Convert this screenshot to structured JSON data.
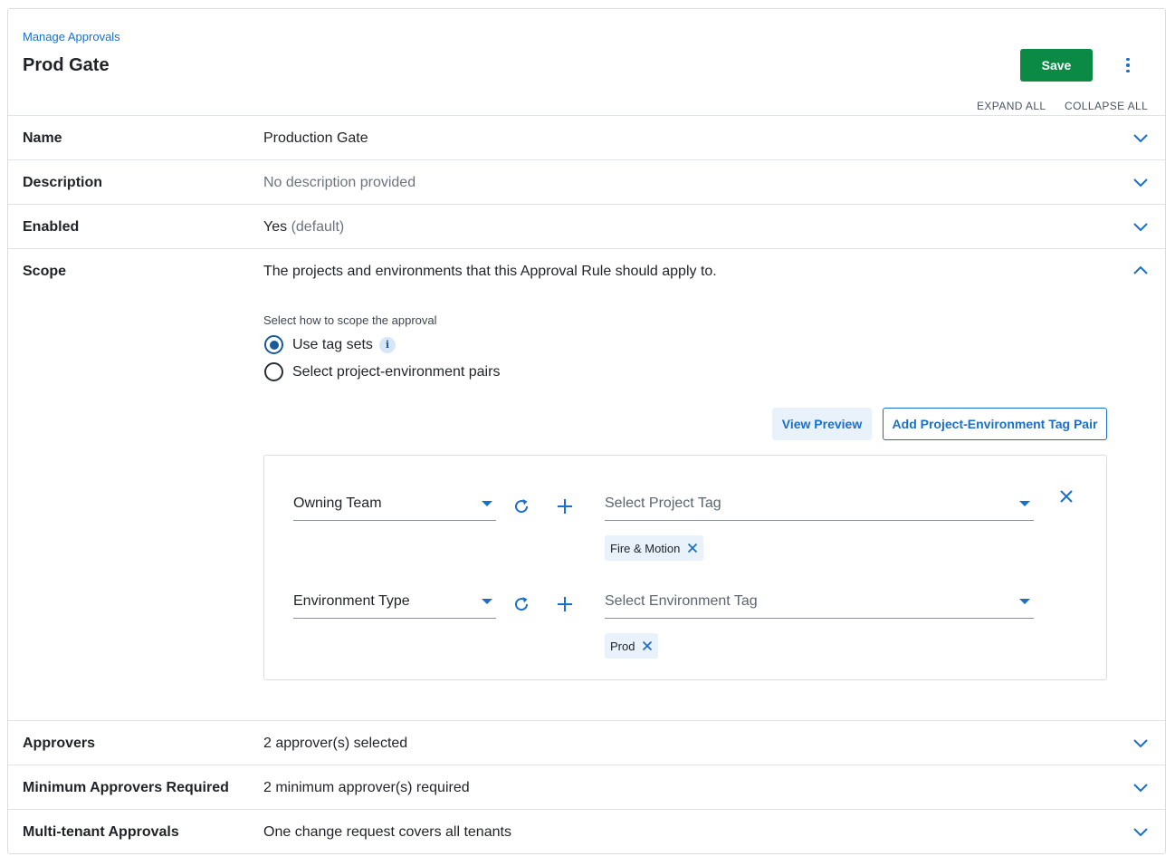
{
  "header": {
    "breadcrumb": "Manage Approvals",
    "title": "Prod Gate",
    "save_label": "Save",
    "expand_all": "EXPAND ALL",
    "collapse_all": "COLLAPSE ALL"
  },
  "rows": {
    "name": {
      "label": "Name",
      "value": "Production Gate"
    },
    "description": {
      "label": "Description",
      "value": "No description provided"
    },
    "enabled": {
      "label": "Enabled",
      "value": "Yes",
      "suffix": "(default)"
    },
    "scope": {
      "label": "Scope",
      "value": "The projects and environments that this Approval Rule should apply to."
    },
    "approvers": {
      "label": "Approvers",
      "value": "2 approver(s) selected"
    },
    "min_approvers": {
      "label": "Minimum Approvers Required",
      "value": "2 minimum approver(s) required"
    },
    "multitenant": {
      "label": "Multi-tenant Approvals",
      "value": "One change request covers all tenants"
    }
  },
  "scope": {
    "hint": "Select how to scope the approval",
    "options": [
      {
        "label": "Use tag sets",
        "selected": true
      },
      {
        "label": "Select project-environment pairs",
        "selected": false
      }
    ],
    "preview_label": "View Preview",
    "add_pair_label": "Add Project-Environment Tag Pair",
    "project": {
      "tag_set": "Owning Team",
      "tag_placeholder": "Select Project Tag",
      "chips": [
        "Fire & Motion"
      ]
    },
    "environment": {
      "tag_set": "Environment Type",
      "tag_placeholder": "Select Environment Tag",
      "chips": [
        "Prod"
      ]
    }
  },
  "colors": {
    "accent": "#1a6fc9",
    "save": "#0b8a46",
    "chip_bg": "#e9f1fa"
  }
}
